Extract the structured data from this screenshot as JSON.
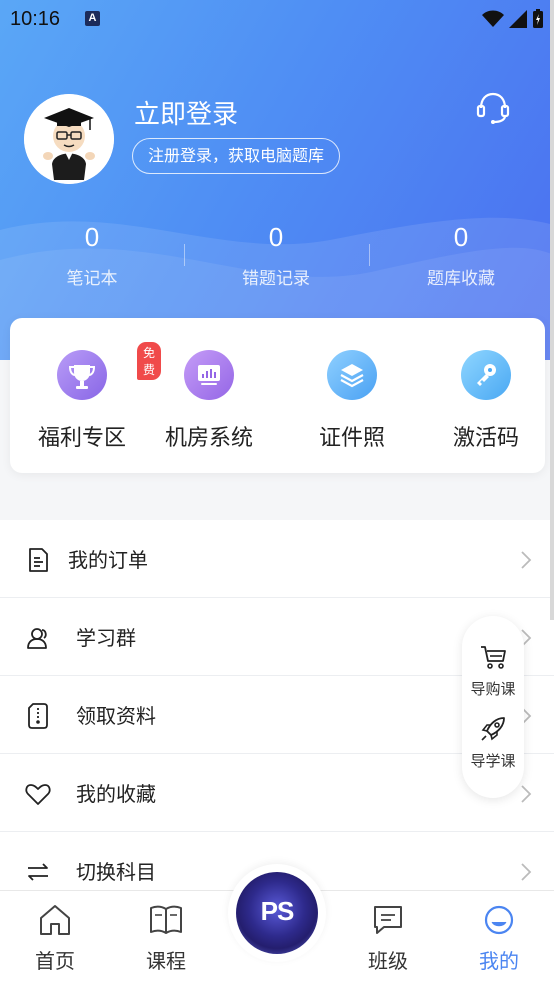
{
  "status_bar": {
    "time": "10:16",
    "a_label": "A"
  },
  "profile": {
    "login_title": "立即登录",
    "register_text": "注册登录，获取电脑题库"
  },
  "stats": [
    {
      "value": "0",
      "label": "笔记本"
    },
    {
      "value": "0",
      "label": "错题记录"
    },
    {
      "value": "0",
      "label": "题库收藏"
    }
  ],
  "quick_actions": [
    {
      "label": "福利专区",
      "badge": "免费",
      "icon": "trophy-icon"
    },
    {
      "label": "机房系统",
      "icon": "monitor-icon"
    },
    {
      "label": "证件照",
      "icon": "layers-icon"
    },
    {
      "label": "激活码",
      "icon": "key-icon"
    }
  ],
  "menu": [
    {
      "label": "我的订单",
      "icon": "order-icon"
    },
    {
      "label": "学习群",
      "icon": "group-icon"
    },
    {
      "label": "领取资料",
      "icon": "file-icon"
    },
    {
      "label": "我的收藏",
      "icon": "heart-icon"
    },
    {
      "label": "切换科目",
      "icon": "switch-icon"
    }
  ],
  "floating": {
    "buy_course": "导购课",
    "learn_course": "导学课"
  },
  "bottom_nav": {
    "home": "首页",
    "courses": "课程",
    "center": "PS",
    "classes": "班级",
    "mine": "我的"
  },
  "colors": {
    "primary": "#4b85f1",
    "badge": "#f04a4a"
  }
}
